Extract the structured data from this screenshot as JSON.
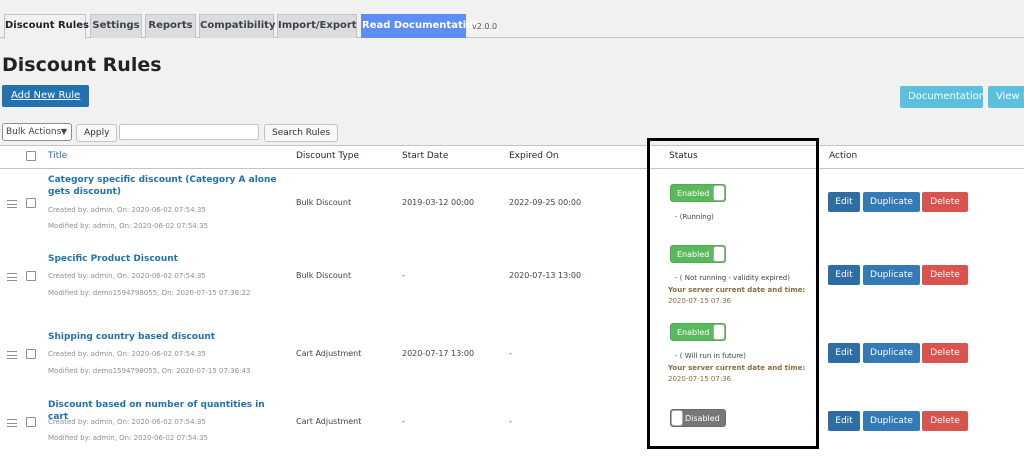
{
  "tabs": [
    {
      "label": "Discount Rules",
      "active": true
    },
    {
      "label": "Settings"
    },
    {
      "label": "Reports"
    },
    {
      "label": "Compatibility"
    },
    {
      "label": "Import/Export"
    },
    {
      "label": "Read Documentation"
    }
  ],
  "version": "v2.0.0",
  "page_title": "Discount Rules",
  "add_new_label": "Add New Rule",
  "documentation_label": "Documentation",
  "view_label": "View E",
  "bulk_actions": {
    "selected": "Bulk Actions"
  },
  "apply_label": "Apply",
  "search": {
    "value": "",
    "placeholder": ""
  },
  "search_button": "Search Rules",
  "columns": {
    "title": "Title",
    "discount_type": "Discount Type",
    "start_date": "Start Date",
    "expired_on": "Expired On",
    "status": "Status",
    "action": "Action"
  },
  "actions": {
    "edit": "Edit",
    "duplicate": "Duplicate",
    "delete": "Delete"
  },
  "rules": [
    {
      "title": "Category specific discount (Category A alone gets discount)",
      "created": "Created by: admin, On: 2020-06-02 07:54:35",
      "modified": "Modified by: admin, On: 2020-06-02 07:54:35",
      "type": "Bulk Discount",
      "start": "2019-03-12 00:00",
      "expires": "2022-09-25 00:00",
      "toggle": "Enabled",
      "status_text": "- (Running)"
    },
    {
      "title": "Specific Product Discount",
      "created": "Created by: admin, On: 2020-06-02 07:54:35",
      "modified": "Modified by: demo1594798055, On: 2020-07-15 07:36:22",
      "type": "Bulk Discount",
      "start": "-",
      "expires": "2020-07-13 13:00",
      "toggle": "Enabled",
      "status_text": "- ( Not running - validity expired)",
      "server_label": "Your server current date and time:",
      "server_time": "2020-07-15 07:36"
    },
    {
      "title": "Shipping country based discount",
      "created": "Created by: admin, On: 2020-06-02 07:54:35",
      "modified": "Modified by: demo1594798055, On: 2020-07-15 07:36:43",
      "type": "Cart Adjustment",
      "start": "2020-07-17 13:00",
      "expires": "-",
      "toggle": "Enabled",
      "status_text": "- ( Will run in future)",
      "server_label": "Your server current date and time:",
      "server_time": "2020-07-15 07:36"
    },
    {
      "title": "Discount based on number of quantities in cart",
      "created": "Created by: admin, On: 2020-06-02 07:54:35",
      "modified": "Modified by: admin, On: 2020-06-02 07:54:35",
      "type": "Cart Adjustment",
      "start": "-",
      "expires": "-",
      "toggle": "Disabled"
    }
  ],
  "colors": {
    "primary": "#2271b1",
    "enabled": "#5cb85c",
    "disabled": "#777777",
    "delete": "#d9534f",
    "info": "#5bc0de",
    "server_text": "#8a6d3b"
  }
}
